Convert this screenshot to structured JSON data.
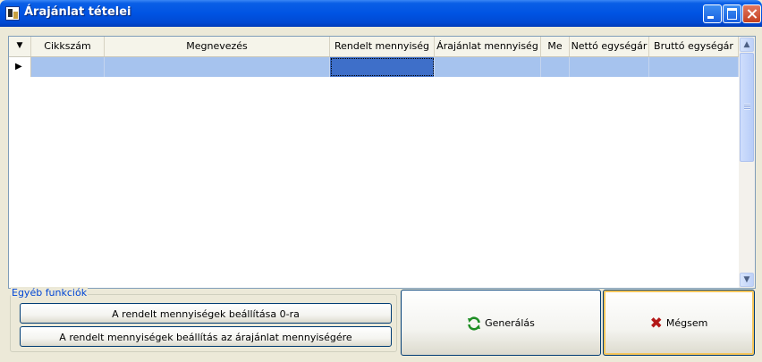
{
  "window": {
    "title": "Árajánlat tételei"
  },
  "grid": {
    "columns": [
      "Cikkszám",
      "Megnevezés",
      "Rendelt mennyiség",
      "Árajánlat mennyiség",
      "Me",
      "Nettó egységár",
      "Bruttó egységár"
    ],
    "rows": [
      [
        "",
        "",
        "",
        "",
        "",
        "",
        ""
      ]
    ],
    "selected_row": 0,
    "focused_column": 2
  },
  "other_functions": {
    "legend": "Egyéb funkciók",
    "set_zero_label": "A rendelt mennyiségek beállítása 0-ra",
    "copy_quote_label": "A rendelt mennyiségek beállítás az árajánlat mennyiségére"
  },
  "actions": {
    "generate_label": "Generálás",
    "cancel_label": "Mégsem"
  },
  "icons": {
    "title": "app-icon",
    "generate": "refresh-icon",
    "cancel": "x-icon"
  },
  "colors": {
    "title_bar": "#0054E3",
    "selected_row": "#A6C3EE",
    "focused_cell": "#3E6FC9",
    "group_legend": "#0046D5",
    "cancel_icon": "#B31818",
    "generate_icon": "#1E8E24"
  }
}
